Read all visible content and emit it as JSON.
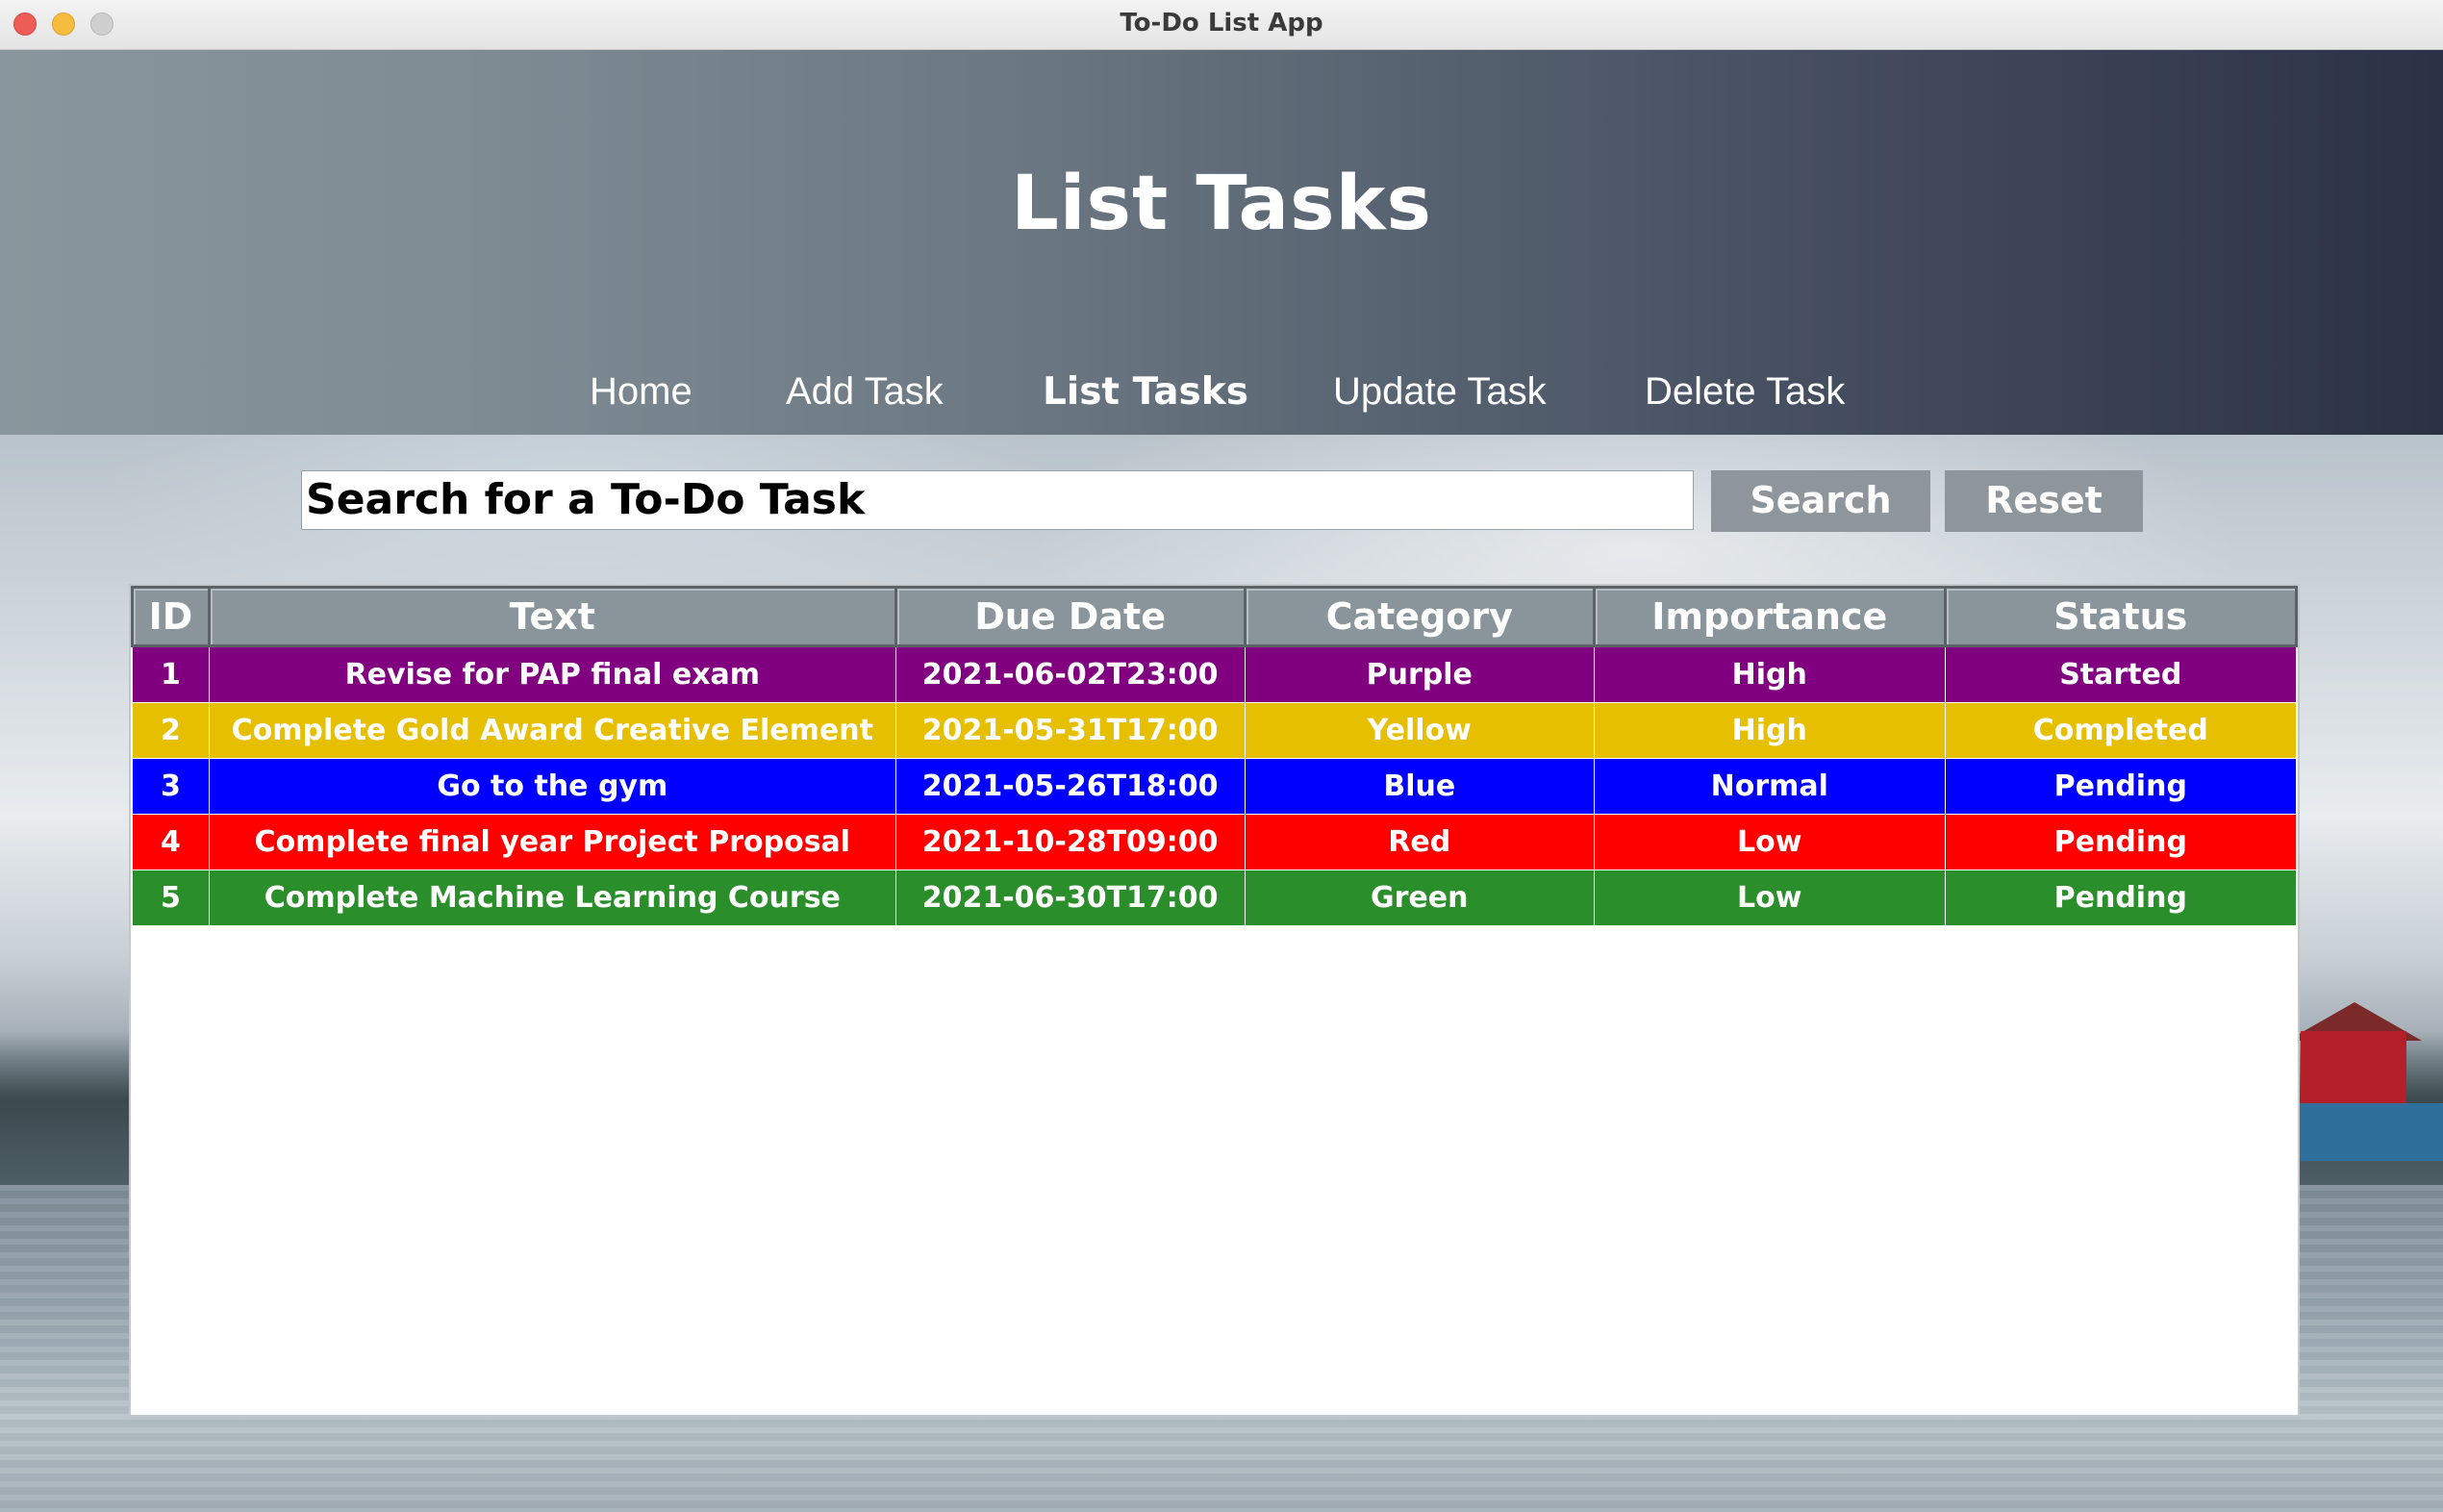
{
  "window": {
    "title": "To-Do List App"
  },
  "page": {
    "title": "List Tasks"
  },
  "nav": {
    "home": "Home",
    "add_task": "Add Task",
    "list_tasks": "List Tasks",
    "update_task": "Update Task",
    "delete_task": "Delete Task"
  },
  "search": {
    "value": "Search for a To-Do Task",
    "search_label": "Search",
    "reset_label": "Reset"
  },
  "table": {
    "columns": [
      "ID",
      "Text",
      "Due Date",
      "Category",
      "Importance",
      "Status"
    ],
    "rows": [
      {
        "id": "1",
        "text": "Revise for PAP final exam",
        "due": "2021-06-02T23:00",
        "category": "Purple",
        "importance": "High",
        "status": "Started",
        "color": "#800080"
      },
      {
        "id": "2",
        "text": "Complete Gold Award Creative Element",
        "due": "2021-05-31T17:00",
        "category": "Yellow",
        "importance": "High",
        "status": "Completed",
        "color": "#e6bf00"
      },
      {
        "id": "3",
        "text": "Go to the gym",
        "due": "2021-05-26T18:00",
        "category": "Blue",
        "importance": "Normal",
        "status": "Pending",
        "color": "#0000ff"
      },
      {
        "id": "4",
        "text": "Complete final year Project Proposal",
        "due": "2021-10-28T09:00",
        "category": "Red",
        "importance": "Low",
        "status": "Pending",
        "color": "#ff0000"
      },
      {
        "id": "5",
        "text": "Complete Machine Learning Course",
        "due": "2021-06-30T17:00",
        "category": "Green",
        "importance": "Low",
        "status": "Pending",
        "color": "#2a8f2a"
      }
    ]
  }
}
